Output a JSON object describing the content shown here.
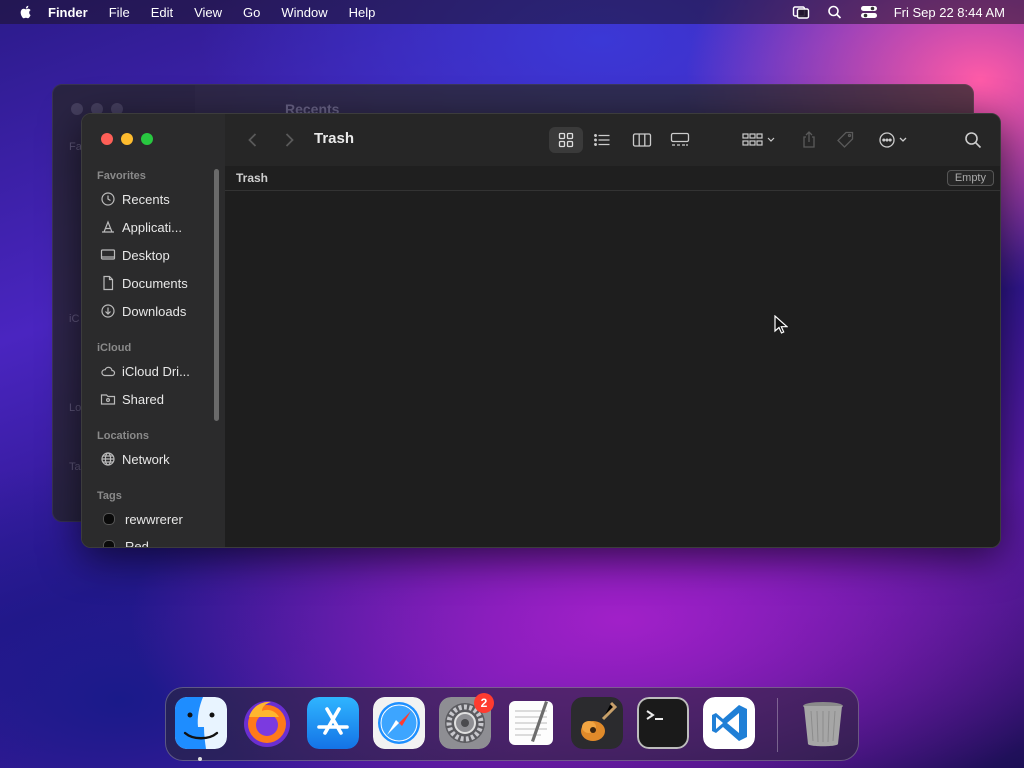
{
  "menubar": {
    "items": [
      "Finder",
      "File",
      "Edit",
      "View",
      "Go",
      "Window",
      "Help"
    ],
    "clock": "Fri Sep 22  8:44 AM"
  },
  "background_window": {
    "title": "Recents",
    "sidebar_labels": [
      "Fa",
      "iC",
      "Lo",
      "Ta"
    ]
  },
  "window": {
    "title": "Trash",
    "path_label": "Trash",
    "empty_button": "Empty",
    "sidebar": {
      "favorites_header": "Favorites",
      "favorites": [
        {
          "label": "Recents",
          "icon": "clock-icon"
        },
        {
          "label": "Applicati...",
          "icon": "applications-icon"
        },
        {
          "label": "Desktop",
          "icon": "desktop-icon"
        },
        {
          "label": "Documents",
          "icon": "document-icon"
        },
        {
          "label": "Downloads",
          "icon": "download-icon"
        }
      ],
      "icloud_header": "iCloud",
      "icloud": [
        {
          "label": "iCloud Dri...",
          "icon": "cloud-icon"
        },
        {
          "label": "Shared",
          "icon": "shared-folder-icon"
        }
      ],
      "locations_header": "Locations",
      "locations": [
        {
          "label": "Network",
          "icon": "globe-icon"
        }
      ],
      "tags_header": "Tags",
      "tags": [
        {
          "label": "rewwrerer"
        },
        {
          "label": "Red"
        }
      ]
    }
  },
  "dock": {
    "apps": [
      "Finder",
      "Firefox",
      "App Store",
      "Safari",
      "System Preferences",
      "TextEdit",
      "GarageBand",
      "Terminal",
      "Visual Studio Code",
      "Trash"
    ],
    "system_prefs_badge": "2"
  },
  "colors": {
    "close": "#fe5f57",
    "minimize": "#febc2e",
    "zoom": "#28c840",
    "badge": "#ff3b30"
  }
}
